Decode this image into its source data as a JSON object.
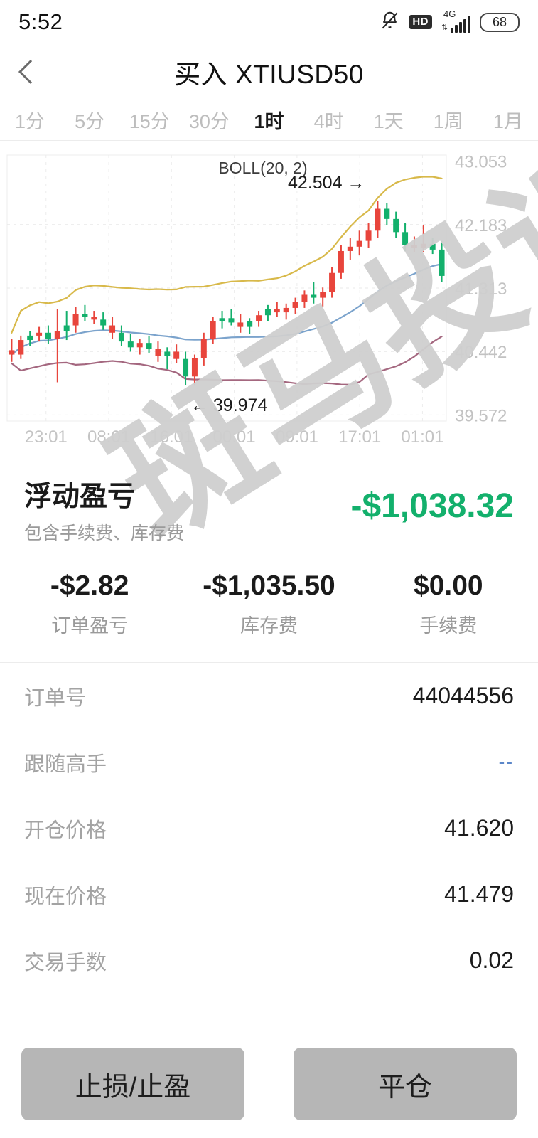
{
  "status_bar": {
    "time": "5:52",
    "hd_label": "HD",
    "network": "4G",
    "battery": "68",
    "icons": [
      "bell-muted-icon",
      "hd-icon",
      "signal-icon",
      "battery-icon"
    ]
  },
  "header": {
    "back_icon": "chevron-left-icon",
    "title": "买入 XTIUSD50"
  },
  "timeframes": {
    "items": [
      {
        "label": "1分",
        "active": false
      },
      {
        "label": "5分",
        "active": false
      },
      {
        "label": "15分",
        "active": false
      },
      {
        "label": "30分",
        "active": false
      },
      {
        "label": "1时",
        "active": true
      },
      {
        "label": "4时",
        "active": false
      },
      {
        "label": "1天",
        "active": false
      },
      {
        "label": "1周",
        "active": false
      },
      {
        "label": "1月",
        "active": false
      }
    ]
  },
  "chart_data": {
    "type": "line",
    "title": "BOLL(20, 2)",
    "subtype": "candlestick with bollinger bands",
    "xlabel": "",
    "ylabel": "",
    "ylim": [
      39.572,
      43.053
    ],
    "grid": true,
    "legend_position": "top-center",
    "y_ticks": [
      "43.053",
      "42.183",
      "41.313",
      "40.442",
      "39.572"
    ],
    "y_tick_values": [
      43.053,
      42.183,
      41.313,
      40.442,
      39.572
    ],
    "x_ticks": [
      "23:01",
      "08:01",
      "16:01",
      "00:01",
      "09:01",
      "17:01",
      "01:01"
    ],
    "annotations": [
      {
        "text": "42.504 →",
        "value": 42.504,
        "type": "high-marker"
      },
      {
        "text": "← 39.974",
        "value": 39.974,
        "type": "low-marker"
      }
    ],
    "series": [
      {
        "name": "BOLL upper",
        "color": "#d8b94a"
      },
      {
        "name": "BOLL middle",
        "color": "#7ba3cc"
      },
      {
        "name": "BOLL lower",
        "color": "#a4677f"
      }
    ],
    "candle_up_color": "#13b06c",
    "candle_down_color": "#e8453c",
    "candles": [
      {
        "o": 40.46,
        "h": 40.62,
        "l": 40.3,
        "c": 40.4,
        "d": 1
      },
      {
        "o": 40.4,
        "h": 40.66,
        "l": 40.34,
        "c": 40.6,
        "d": 1
      },
      {
        "o": 40.6,
        "h": 40.72,
        "l": 40.52,
        "c": 40.66,
        "d": 0
      },
      {
        "o": 40.66,
        "h": 40.78,
        "l": 40.58,
        "c": 40.7,
        "d": 1
      },
      {
        "o": 40.7,
        "h": 40.8,
        "l": 40.55,
        "c": 40.62,
        "d": 0
      },
      {
        "o": 40.62,
        "h": 41.02,
        "l": 40.02,
        "c": 40.72,
        "d": 1
      },
      {
        "o": 40.72,
        "h": 41.0,
        "l": 40.6,
        "c": 40.8,
        "d": 0
      },
      {
        "o": 40.8,
        "h": 41.05,
        "l": 40.7,
        "c": 40.96,
        "d": 1
      },
      {
        "o": 40.96,
        "h": 41.08,
        "l": 40.86,
        "c": 40.92,
        "d": 0
      },
      {
        "o": 40.92,
        "h": 41.0,
        "l": 40.82,
        "c": 40.88,
        "d": 1
      },
      {
        "o": 40.88,
        "h": 40.98,
        "l": 40.74,
        "c": 40.8,
        "d": 0
      },
      {
        "o": 40.8,
        "h": 40.92,
        "l": 40.62,
        "c": 40.7,
        "d": 1
      },
      {
        "o": 40.7,
        "h": 40.8,
        "l": 40.52,
        "c": 40.58,
        "d": 0
      },
      {
        "o": 40.58,
        "h": 40.68,
        "l": 40.44,
        "c": 40.5,
        "d": 0
      },
      {
        "o": 40.5,
        "h": 40.62,
        "l": 40.4,
        "c": 40.56,
        "d": 1
      },
      {
        "o": 40.56,
        "h": 40.66,
        "l": 40.42,
        "c": 40.48,
        "d": 0
      },
      {
        "o": 40.48,
        "h": 40.58,
        "l": 40.3,
        "c": 40.38,
        "d": 1
      },
      {
        "o": 40.38,
        "h": 40.5,
        "l": 40.2,
        "c": 40.44,
        "d": 0
      },
      {
        "o": 40.44,
        "h": 40.54,
        "l": 40.28,
        "c": 40.34,
        "d": 1
      },
      {
        "o": 40.34,
        "h": 40.44,
        "l": 39.98,
        "c": 40.1,
        "d": 0
      },
      {
        "o": 40.1,
        "h": 40.4,
        "l": 39.974,
        "c": 40.35,
        "d": 1
      },
      {
        "o": 40.35,
        "h": 40.7,
        "l": 40.25,
        "c": 40.62,
        "d": 1
      },
      {
        "o": 40.62,
        "h": 40.92,
        "l": 40.55,
        "c": 40.86,
        "d": 1
      },
      {
        "o": 40.86,
        "h": 41.0,
        "l": 40.76,
        "c": 40.9,
        "d": 0
      },
      {
        "o": 40.9,
        "h": 41.02,
        "l": 40.8,
        "c": 40.84,
        "d": 0
      },
      {
        "o": 40.84,
        "h": 40.96,
        "l": 40.7,
        "c": 40.78,
        "d": 1
      },
      {
        "o": 40.78,
        "h": 40.9,
        "l": 40.68,
        "c": 40.86,
        "d": 0
      },
      {
        "o": 40.86,
        "h": 41.0,
        "l": 40.78,
        "c": 40.94,
        "d": 1
      },
      {
        "o": 40.94,
        "h": 41.08,
        "l": 40.86,
        "c": 41.02,
        "d": 0
      },
      {
        "o": 41.02,
        "h": 41.12,
        "l": 40.92,
        "c": 40.98,
        "d": 1
      },
      {
        "o": 40.98,
        "h": 41.1,
        "l": 40.88,
        "c": 41.04,
        "d": 1
      },
      {
        "o": 41.04,
        "h": 41.18,
        "l": 40.96,
        "c": 41.12,
        "d": 1
      },
      {
        "o": 41.12,
        "h": 41.28,
        "l": 41.04,
        "c": 41.22,
        "d": 1
      },
      {
        "o": 41.22,
        "h": 41.4,
        "l": 41.1,
        "c": 41.18,
        "d": 0
      },
      {
        "o": 41.18,
        "h": 41.32,
        "l": 41.06,
        "c": 41.26,
        "d": 1
      },
      {
        "o": 41.26,
        "h": 41.6,
        "l": 41.18,
        "c": 41.52,
        "d": 1
      },
      {
        "o": 41.52,
        "h": 41.9,
        "l": 41.44,
        "c": 41.82,
        "d": 1
      },
      {
        "o": 41.82,
        "h": 42.0,
        "l": 41.7,
        "c": 41.88,
        "d": 1
      },
      {
        "o": 41.88,
        "h": 42.1,
        "l": 41.76,
        "c": 41.96,
        "d": 1
      },
      {
        "o": 41.96,
        "h": 42.2,
        "l": 41.86,
        "c": 42.1,
        "d": 1
      },
      {
        "o": 42.1,
        "h": 42.504,
        "l": 42.0,
        "c": 42.4,
        "d": 1
      },
      {
        "o": 42.4,
        "h": 42.48,
        "l": 42.18,
        "c": 42.26,
        "d": 0
      },
      {
        "o": 42.26,
        "h": 42.36,
        "l": 42.0,
        "c": 42.08,
        "d": 0
      },
      {
        "o": 42.08,
        "h": 42.2,
        "l": 41.82,
        "c": 41.9,
        "d": 0
      },
      {
        "o": 41.9,
        "h": 42.02,
        "l": 41.8,
        "c": 41.86,
        "d": 1
      },
      {
        "o": 41.86,
        "h": 42.18,
        "l": 41.8,
        "c": 41.92,
        "d": 1
      },
      {
        "o": 41.92,
        "h": 42.0,
        "l": 41.78,
        "c": 41.84,
        "d": 0
      },
      {
        "o": 41.84,
        "h": 41.96,
        "l": 41.4,
        "c": 41.479,
        "d": 0
      }
    ]
  },
  "pnl": {
    "title": "浮动盈亏",
    "subtitle": "包含手续费、库存费",
    "amount": "-$1,038.32",
    "amount_color": "#13b06c",
    "breakdown": [
      {
        "value": "-$2.82",
        "label": "订单盈亏"
      },
      {
        "value": "-$1,035.50",
        "label": "库存费"
      },
      {
        "value": "$0.00",
        "label": "手续费"
      }
    ]
  },
  "details": [
    {
      "key": "订单号",
      "value": "44044556",
      "muted": false
    },
    {
      "key": "跟随高手",
      "value": "--",
      "muted": true
    },
    {
      "key": "开仓价格",
      "value": "41.620",
      "muted": false
    },
    {
      "key": "现在价格",
      "value": "41.479",
      "muted": false
    },
    {
      "key": "交易手数",
      "value": "0.02",
      "muted": false
    }
  ],
  "actions": {
    "stop_label": "止损/止盈",
    "close_label": "平仓"
  },
  "watermark": {
    "text": "斑马投诉"
  }
}
